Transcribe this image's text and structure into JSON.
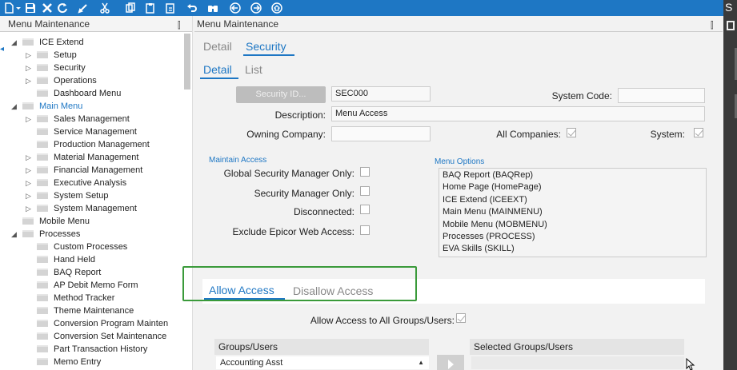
{
  "toolbar": {
    "icons": [
      "new-icon",
      "dropdown-icon",
      "save-icon",
      "delete-icon",
      "refresh-icon",
      "clear-icon",
      "cut-icon",
      "copy-icon",
      "paste-icon",
      "undo-icon",
      "search-binoculars-icon",
      "back-icon",
      "forward-icon",
      "home-icon"
    ]
  },
  "tree": {
    "title": "Menu Maintenance",
    "pin": "⫿",
    "items": [
      {
        "label": "ICE Extend",
        "level": 0,
        "expander": "◢"
      },
      {
        "label": "Setup",
        "level": 1,
        "expander": "▷"
      },
      {
        "label": "Security",
        "level": 1,
        "expander": "▷"
      },
      {
        "label": "Operations",
        "level": 1,
        "expander": "▷"
      },
      {
        "label": "Dashboard Menu",
        "level": 1,
        "expander": ""
      },
      {
        "label": "Main Menu",
        "level": 0,
        "expander": "◢",
        "selected": true
      },
      {
        "label": "Sales Management",
        "level": 1,
        "expander": "▷"
      },
      {
        "label": "Service Management",
        "level": 1,
        "expander": ""
      },
      {
        "label": "Production Management",
        "level": 1,
        "expander": ""
      },
      {
        "label": "Material Management",
        "level": 1,
        "expander": "▷"
      },
      {
        "label": "Financial Management",
        "level": 1,
        "expander": "▷"
      },
      {
        "label": "Executive Analysis",
        "level": 1,
        "expander": "▷"
      },
      {
        "label": "System Setup",
        "level": 1,
        "expander": "▷"
      },
      {
        "label": "System Management",
        "level": 1,
        "expander": "▷"
      },
      {
        "label": "Mobile Menu",
        "level": 0,
        "expander": ""
      },
      {
        "label": "Processes",
        "level": 0,
        "expander": "◢"
      },
      {
        "label": "Custom Processes",
        "level": 1,
        "expander": ""
      },
      {
        "label": "Hand Held",
        "level": 1,
        "expander": ""
      },
      {
        "label": "BAQ Report",
        "level": 1,
        "expander": ""
      },
      {
        "label": "AP Debit Memo Form",
        "level": 1,
        "expander": ""
      },
      {
        "label": "Method Tracker",
        "level": 1,
        "expander": ""
      },
      {
        "label": "Theme Maintenance",
        "level": 1,
        "expander": ""
      },
      {
        "label": "Conversion Program Mainten",
        "level": 1,
        "expander": ""
      },
      {
        "label": "Conversion Set Maintenance",
        "level": 1,
        "expander": ""
      },
      {
        "label": "Part Transaction History",
        "level": 1,
        "expander": ""
      },
      {
        "label": "Memo Entry",
        "level": 1,
        "expander": ""
      }
    ]
  },
  "content": {
    "title": "Menu Maintenance",
    "pin": "⫿",
    "top_tabs": [
      {
        "label": "Detail",
        "active": false
      },
      {
        "label": "Security",
        "active": true
      }
    ],
    "sub_tabs": [
      {
        "label": "Detail",
        "active": true
      },
      {
        "label": "List",
        "active": false
      }
    ],
    "security_id_button": "Security ID...",
    "security_id_value": "SEC000",
    "system_code_label": "System Code:",
    "system_code_value": "",
    "description_label": "Description:",
    "description_value": "Menu Access",
    "owning_company_label": "Owning Company:",
    "owning_company_value": "",
    "all_companies_label": "All Companies:",
    "system_label": "System:",
    "maintain_access_title": "Maintain Access",
    "global_security_manager_label": "Global Security Manager Only:",
    "security_manager_label": "Security Manager Only:",
    "disconnected_label": "Disconnected:",
    "exclude_web_access_label": "Exclude Epicor Web Access:",
    "menu_options_title": "Menu Options",
    "menu_options": [
      "BAQ Report (BAQRep)",
      "Home Page (HomePage)",
      "ICE Extend (ICEEXT)",
      "Main Menu (MAINMENU)",
      "Mobile Menu (MOBMENU)",
      "Processes (PROCESS)",
      "EVA Skills (SKILL)"
    ],
    "access_tabs": [
      {
        "label": "Allow Access",
        "active": true
      },
      {
        "label": "Disallow Access",
        "active": false
      }
    ],
    "allow_all_label": "Allow Access to All Groups/Users:",
    "groups_users_header": "Groups/Users",
    "selected_groups_header": "Selected Groups/Users",
    "groups_rows": [
      "Accounting Asst"
    ],
    "scroll_up_glyph": "▲"
  },
  "right_edge": {
    "letter": "S"
  },
  "colors": {
    "accent": "#1e77c4",
    "highlight": "#3a9a3a"
  }
}
